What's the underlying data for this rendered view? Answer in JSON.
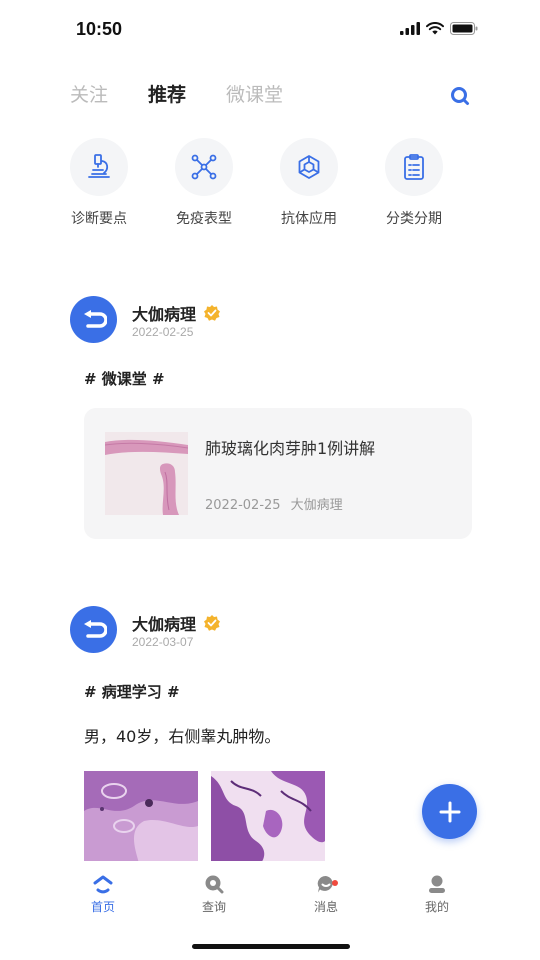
{
  "status_bar": {
    "time": "10:50"
  },
  "top_tabs": [
    {
      "label": "关注",
      "active": false
    },
    {
      "label": "推荐",
      "active": true
    },
    {
      "label": "微课堂",
      "active": false
    }
  ],
  "categories": [
    {
      "label": "诊断要点",
      "icon": "microscope-icon"
    },
    {
      "label": "免疫表型",
      "icon": "molecule-icon"
    },
    {
      "label": "抗体应用",
      "icon": "hexagon-network-icon"
    },
    {
      "label": "分类分期",
      "icon": "clipboard-icon"
    }
  ],
  "posts": [
    {
      "author": "大伽病理",
      "date": "2022-02-25",
      "topic": "# 微课堂 #",
      "card": {
        "title": "肺玻璃化肉芽肿1例讲解",
        "date": "2022-02-25",
        "source": "大伽病理"
      }
    },
    {
      "author": "大伽病理",
      "date": "2022-03-07",
      "topic": "# 病理学习 #",
      "text": "男，40岁，右侧睾丸肿物。"
    }
  ],
  "bottom_nav": [
    {
      "label": "首页",
      "icon": "home-icon",
      "active": true
    },
    {
      "label": "查询",
      "icon": "search-icon",
      "active": false
    },
    {
      "label": "消息",
      "icon": "message-icon",
      "active": false,
      "badge": true
    },
    {
      "label": "我的",
      "icon": "profile-icon",
      "active": false
    }
  ],
  "colors": {
    "accent": "#3a6fe6",
    "badge": "#f04a3e",
    "icon_blue": "#3a6fe6"
  }
}
